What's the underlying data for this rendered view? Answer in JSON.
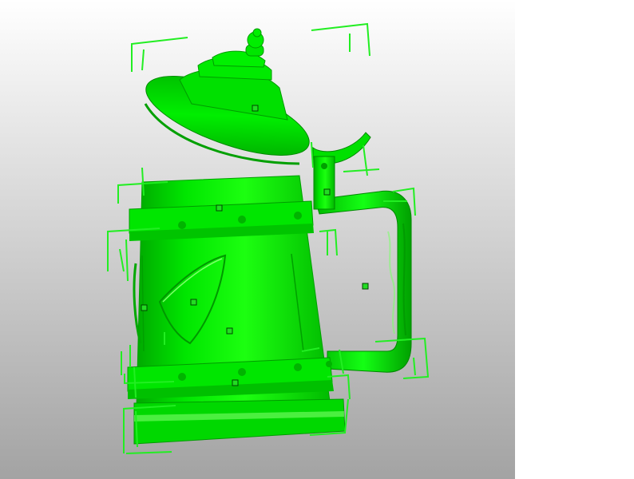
{
  "viewport": {
    "background_top": "#ffffff",
    "background_bottom": "#a3a3a3",
    "model_color": "#00e600",
    "model_shadow": "#009c00",
    "model_highlight": "#7dff6a",
    "bbox_bracket_color": "#22ee22",
    "handle_fill": "#22dd22",
    "handle_stroke": "#004400"
  },
  "model": {
    "name_icon": "beer-stein-model",
    "selected_objects": 9
  }
}
